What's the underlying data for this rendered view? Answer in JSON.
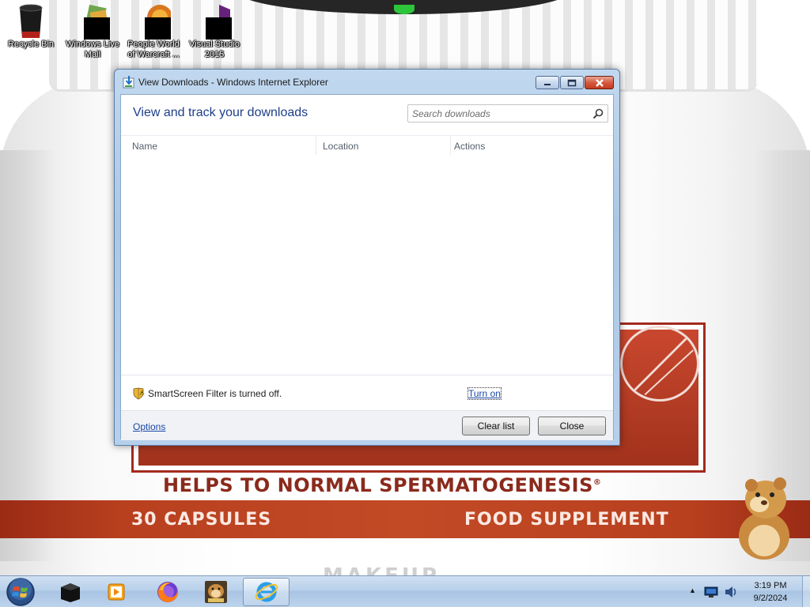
{
  "desktop": {
    "icons": [
      {
        "label": "Recycle Bin",
        "icon": "recycle-bin-icon"
      },
      {
        "label": "Windows Live Mail",
        "icon": "windows-live-mail-icon"
      },
      {
        "label": "People World of Warcraft ...",
        "icon": "people-world-of-warcraft-icon"
      },
      {
        "label": "Visual Studio 2015",
        "icon": "visual-studio-icon"
      }
    ],
    "wallpaper": {
      "headline": "HELPS TO NORMAL SPERMATOGENESIS",
      "trademark": "®",
      "left_band": "30 CAPSULES",
      "right_band": "FOOD SUPPLEMENT",
      "brand": "MAKEUP"
    }
  },
  "window": {
    "title": "View Downloads - Windows Internet Explorer",
    "heading": "View and track your downloads",
    "search": {
      "placeholder": "Search downloads",
      "value": ""
    },
    "columns": [
      "Name",
      "Location",
      "Actions"
    ],
    "downloads": [],
    "smartscreen": {
      "text": "SmartScreen Filter is turned off.",
      "action": "Turn on"
    },
    "footer": {
      "options": "Options",
      "clear_list": "Clear list",
      "close": "Close"
    }
  },
  "taskbar": {
    "items": [
      {
        "name": "start-button"
      },
      {
        "name": "taskbar-black-app",
        "icon": "black-box-icon"
      },
      {
        "name": "taskbar-media-player",
        "icon": "media-player-icon"
      },
      {
        "name": "taskbar-firefox",
        "icon": "firefox-icon"
      },
      {
        "name": "taskbar-box-app",
        "icon": "hamster-box-icon"
      },
      {
        "name": "taskbar-internet-explorer",
        "icon": "internet-explorer-icon",
        "active": true
      }
    ],
    "clock": {
      "time": "3:19 PM",
      "date": "9/2/2024"
    }
  },
  "colors": {
    "accent_link": "#1a47a8",
    "heading": "#1e3f8a",
    "window_frame": "#aac8e6",
    "close_button": "#c23b1f",
    "wallpaper_red": "#a1321c"
  }
}
